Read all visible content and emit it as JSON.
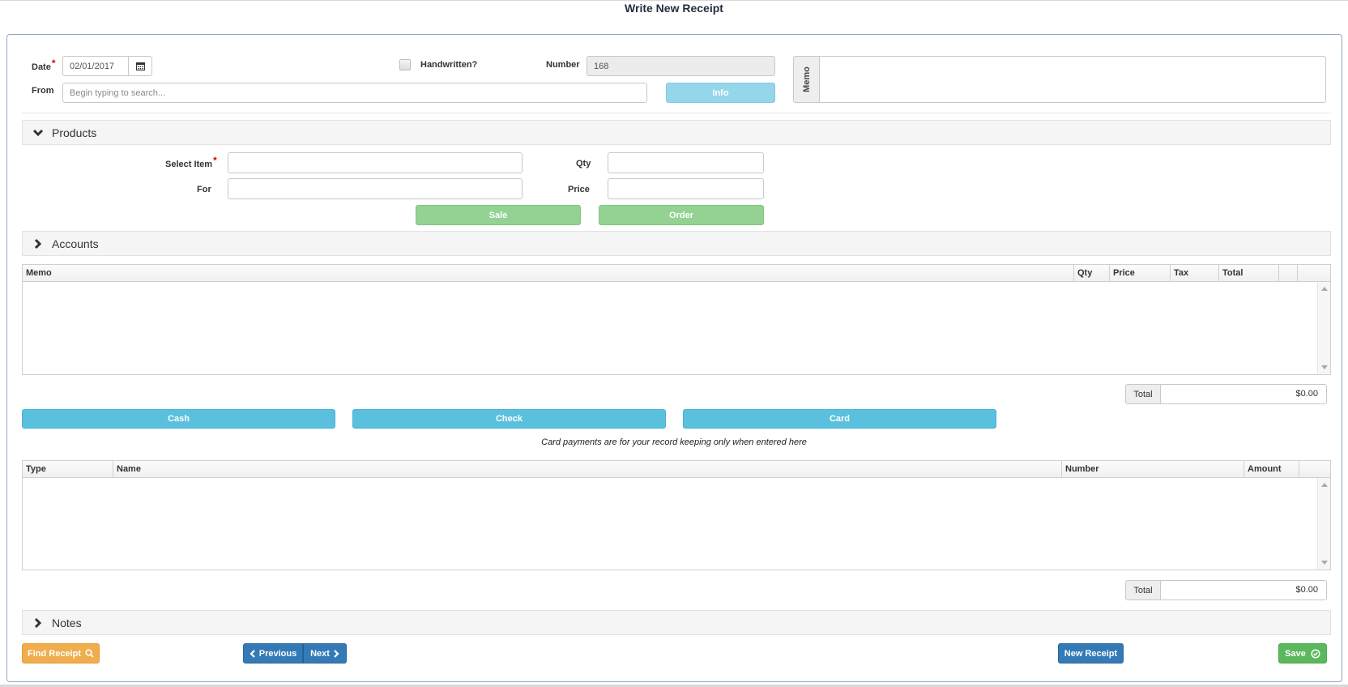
{
  "page": {
    "title": "Write New Receipt"
  },
  "header": {
    "date_label": "Date",
    "date_value": "02/01/2017",
    "handwritten_label": "Handwritten?",
    "number_label": "Number",
    "number_value": "168",
    "from_label": "From",
    "from_placeholder": "Begin typing to search...",
    "info_button": "Info",
    "memo_label": "Memo"
  },
  "products": {
    "title": "Products",
    "select_item_label": "Select Item",
    "qty_label": "Qty",
    "for_label": "For",
    "price_label": "Price",
    "sale_button": "Sale",
    "order_button": "Order"
  },
  "accounts": {
    "title": "Accounts",
    "columns": [
      "Memo",
      "Qty",
      "Price",
      "Tax",
      "Total"
    ],
    "total_label": "Total",
    "total_value": "$0.00"
  },
  "payments": {
    "cash_button": "Cash",
    "check_button": "Check",
    "card_button": "Card",
    "card_note": "Card payments are for your record keeping only when entered here",
    "columns": [
      "Type",
      "Name",
      "Number",
      "Amount"
    ],
    "total_label": "Total",
    "total_value": "$0.00"
  },
  "notes": {
    "title": "Notes"
  },
  "footer": {
    "find_receipt": "Find Receipt",
    "previous": "Previous",
    "next": "Next",
    "new_receipt": "New Receipt",
    "save": "Save"
  },
  "colors": {
    "info": "#5bc0de",
    "success": "#5cb85c",
    "warning": "#f0ad4e",
    "primary": "#337ab7"
  }
}
